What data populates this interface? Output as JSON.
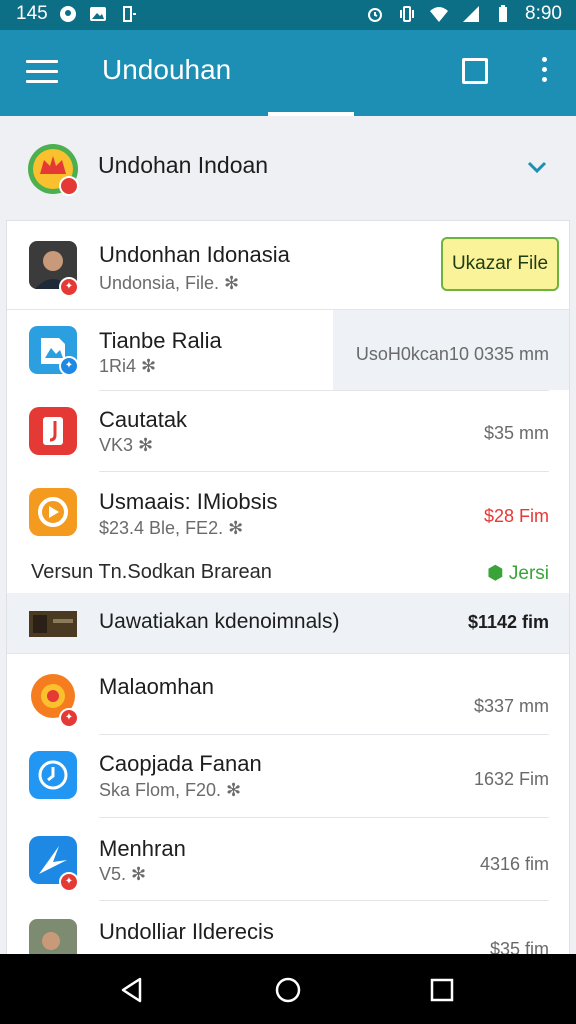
{
  "status_bar": {
    "left_text": "145",
    "time": "8:90",
    "icons_left": [
      "circle-notification-icon",
      "image-notification-icon",
      "battery-notification-icon"
    ],
    "icons_right": [
      "alarm-icon",
      "vibrate-icon",
      "wifi-icon",
      "signal-icon",
      "battery-icon"
    ]
  },
  "app_bar": {
    "title": "Undouhan",
    "icons": [
      "menu-icon",
      "square-icon",
      "more-vert-icon"
    ]
  },
  "account": {
    "name": "Undohan Indoan",
    "icon": "chevron-down-icon"
  },
  "list": {
    "items": [
      {
        "title": "Undonhan Idonasia",
        "subtitle": "Undonsia, File. ✻",
        "action_label": "Ukazar File"
      },
      {
        "title": "Tianbe Ralia",
        "subtitle": "1Ri4 ✻",
        "value": "UsoH0kcan10  0335 mm"
      },
      {
        "title": "Cautatak",
        "subtitle": "VK3 ✻",
        "value": "$35 mm"
      },
      {
        "title": "Usmaais: IMiobsis",
        "subtitle": "$23.4 Ble, FE2. ✻",
        "value": "$28 Fim",
        "value_color": "#e53935"
      },
      {
        "title": "Versun Tn.Sodkan Brarean",
        "value": "Jersi",
        "value_color": "#3aa43a"
      },
      {
        "title": "Uawatiakan kdenoimnals)",
        "value": "$1142 fim"
      },
      {
        "title": "Malaomhan",
        "value": "$337 mm"
      },
      {
        "title": "Caopjada Fanan",
        "subtitle": "Ska Flom, F20. ✻",
        "value": "1632 Fim"
      },
      {
        "title": "Menhran",
        "subtitle": "V5. ✻",
        "value": "4316 fim"
      },
      {
        "title": "Undolliar Ilderecis",
        "value": "$35 fim"
      }
    ]
  },
  "nav_bar": {
    "icons": [
      "back-icon",
      "home-icon",
      "recents-icon"
    ]
  },
  "colors": {
    "status_bar": "#0c6f86",
    "app_bar": "#1e8fb4",
    "accent_green": "#6cb33f",
    "badge_red": "#e53935"
  }
}
